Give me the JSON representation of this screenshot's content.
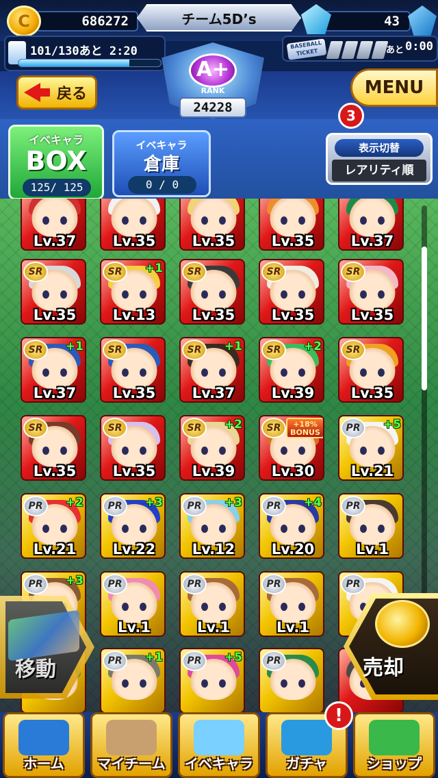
{
  "top_bar": {
    "coins": "686272",
    "team_name": "チーム5D’s",
    "gems": "43"
  },
  "stamina": {
    "text": "101/130あと 2:20",
    "fraction": 0.777
  },
  "ticket": {
    "icon_text": "BASEBALL TICKET",
    "label": "あと",
    "time": "0:00"
  },
  "header": {
    "back_label": "戻る",
    "rank": {
      "grade": "A+",
      "label": "RANK",
      "score": "24228"
    },
    "menu_label": "MENU"
  },
  "tabs": {
    "box": {
      "sub": "イベキャラ",
      "main": "BOX",
      "count": "125/ 125"
    },
    "storage": {
      "sub": "イベキャラ",
      "main": "倉庫",
      "count": "0 / 0"
    }
  },
  "sort": {
    "badge": "3",
    "toggle_label": "表示切替",
    "value": "レアリティ順"
  },
  "cards": [
    {
      "rarity": "",
      "plus": "",
      "level": "Lv.37",
      "hair": "#d23030"
    },
    {
      "rarity": "",
      "plus": "",
      "level": "Lv.35",
      "hair": "#f2f2f2"
    },
    {
      "rarity": "",
      "plus": "",
      "level": "Lv.35",
      "hair": "#f4d470"
    },
    {
      "rarity": "",
      "plus": "",
      "level": "Lv.35",
      "hair": "#f08c2a"
    },
    {
      "rarity": "",
      "plus": "",
      "level": "Lv.37",
      "hair": "#1e8a4a"
    },
    {
      "rarity": "SR",
      "plus": "",
      "level": "Lv.35",
      "hair": "#d8d8d8"
    },
    {
      "rarity": "SR",
      "plus": "+1",
      "level": "Lv.13",
      "hair": "#f4d040"
    },
    {
      "rarity": "SR",
      "plus": "",
      "level": "Lv.35",
      "hair": "#3a3a3a"
    },
    {
      "rarity": "SR",
      "plus": "",
      "level": "Lv.35",
      "hair": "#f2ece0"
    },
    {
      "rarity": "SR",
      "plus": "",
      "level": "Lv.35",
      "hair": "#f4b8c8"
    },
    {
      "rarity": "SR",
      "plus": "+1",
      "level": "Lv.37",
      "hair": "#2c5ab8"
    },
    {
      "rarity": "SR",
      "plus": "",
      "level": "Lv.35",
      "hair": "#2c5ab8"
    },
    {
      "rarity": "SR",
      "plus": "+1",
      "level": "Lv.37",
      "hair": "#3a2a20"
    },
    {
      "rarity": "SR",
      "plus": "+2",
      "level": "Lv.39",
      "hair": "#3cbc5a"
    },
    {
      "rarity": "SR",
      "plus": "",
      "level": "Lv.35",
      "hair": "#f0a020"
    },
    {
      "rarity": "SR",
      "plus": "",
      "level": "Lv.35",
      "hair": "#7a3a2a"
    },
    {
      "rarity": "SR",
      "plus": "",
      "level": "Lv.35",
      "hair": "#d8c0e8"
    },
    {
      "rarity": "SR",
      "plus": "+2",
      "level": "Lv.39",
      "hair": "#e8d890"
    },
    {
      "rarity": "SR",
      "plus": "",
      "level": "Lv.30",
      "hair": "#d87020",
      "bonus": "+18% BONUS"
    },
    {
      "rarity": "PR",
      "plus": "+5",
      "level": "Lv.21",
      "hair": "#f4f4f4"
    },
    {
      "rarity": "PR",
      "plus": "+2",
      "level": "Lv.21",
      "hair": "#e83030"
    },
    {
      "rarity": "PR",
      "plus": "+3",
      "level": "Lv.22",
      "hair": "#2040c8"
    },
    {
      "rarity": "PR",
      "plus": "+3",
      "level": "Lv.12",
      "hair": "#8ad0e8"
    },
    {
      "rarity": "PR",
      "plus": "+4",
      "level": "Lv.20",
      "hair": "#2a3aa0"
    },
    {
      "rarity": "PR",
      "plus": "",
      "level": "Lv.1",
      "hair": "#4a3a30"
    },
    {
      "rarity": "PR",
      "plus": "+3",
      "level": "",
      "hair": "#8a5a30"
    },
    {
      "rarity": "PR",
      "plus": "",
      "level": "Lv.1",
      "hair": "#f08cb0"
    },
    {
      "rarity": "PR",
      "plus": "",
      "level": "Lv.1",
      "hair": "#a86a3a"
    },
    {
      "rarity": "PR",
      "plus": "",
      "level": "Lv.1",
      "hair": "#a86a3a"
    },
    {
      "rarity": "PR",
      "plus": "",
      "level": "",
      "hair": "#f4f4f4"
    },
    {
      "rarity": "PR",
      "plus": "",
      "level": "",
      "hair": "#5a8a5a"
    },
    {
      "rarity": "PR",
      "plus": "+1",
      "level": "",
      "hair": "#7a7a6a"
    },
    {
      "rarity": "PR",
      "plus": "+5",
      "level": "",
      "hair": "#e04a9a"
    },
    {
      "rarity": "PR",
      "plus": "",
      "level": "",
      "hair": "#2a8a4a"
    },
    {
      "rarity": "",
      "plus": "",
      "level": "",
      "hair": "#4a4a4a"
    }
  ],
  "actions": {
    "move_label": "移動",
    "sell_label": "売却"
  },
  "nav": [
    {
      "label": "ホーム",
      "icon": "home-icon",
      "color": "#2a7ad8"
    },
    {
      "label": "マイチーム",
      "icon": "team-icon",
      "color": "#c8a070"
    },
    {
      "label": "イベキャラ",
      "icon": "event-chara-icon",
      "color": "#7ad0ff"
    },
    {
      "label": "ガチャ",
      "icon": "gacha-icon",
      "color": "#2a9ae0"
    },
    {
      "label": "ショップ",
      "icon": "shop-icon",
      "color": "#3ab84a"
    }
  ],
  "nav_alert": "!",
  "colors": {
    "sr_card": "#e01818",
    "pr_card": "#f2c400",
    "plus_text": "#5aff4a"
  }
}
